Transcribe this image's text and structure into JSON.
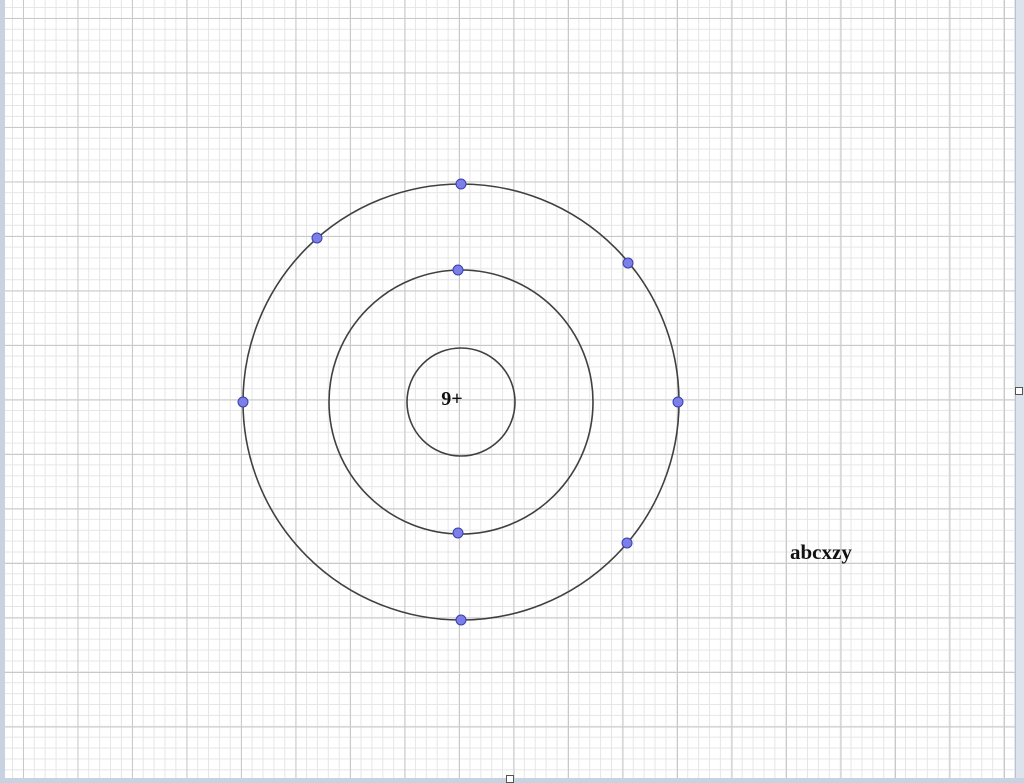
{
  "diagram": {
    "nucleus_label": "9+",
    "side_text": "abcxzy",
    "shells": [
      {
        "name": "nucleus",
        "electrons": 0
      },
      {
        "name": "inner-shell",
        "electrons": 2
      },
      {
        "name": "outer-shell",
        "electrons": 7
      }
    ],
    "colors": {
      "electron": "#7b7fea",
      "orbit": "#404040",
      "grid_major": "#c9c9c9",
      "grid_minor": "#e6e6e6"
    }
  }
}
